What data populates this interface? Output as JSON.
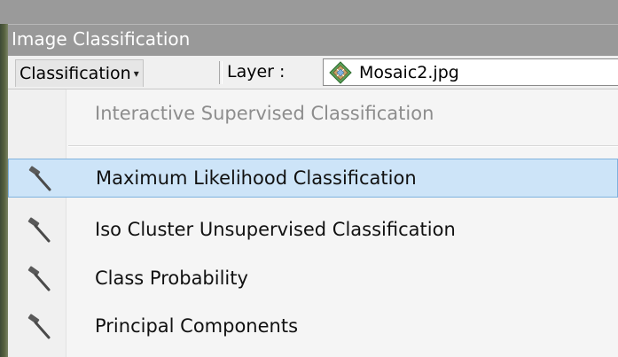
{
  "window": {
    "title": "Image Classification"
  },
  "toolbar": {
    "classification_menu_label": "Classification",
    "classification_caret": "▾",
    "layer_label": "Layer :",
    "layer_value": "Mosaic2.jpg",
    "layer_icon": "raster-layer-icon"
  },
  "menu": {
    "items": [
      {
        "label": "Interactive Supervised Classification",
        "enabled": false,
        "icon": null
      },
      {
        "label": "Maximum Likelihood Classification",
        "enabled": true,
        "highlighted": true,
        "icon": "hammer-icon"
      },
      {
        "label": "Iso Cluster Unsupervised Classification",
        "enabled": true,
        "icon": "hammer-icon"
      },
      {
        "label": "Class Probability",
        "enabled": true,
        "icon": "hammer-icon"
      },
      {
        "label": "Principal Components",
        "enabled": true,
        "icon": "hammer-icon"
      }
    ]
  },
  "colors": {
    "title_bar": "#999999",
    "highlight_fill": "#cde4f8",
    "highlight_border": "#7fb2de",
    "disabled_text": "#8d8d8d"
  }
}
